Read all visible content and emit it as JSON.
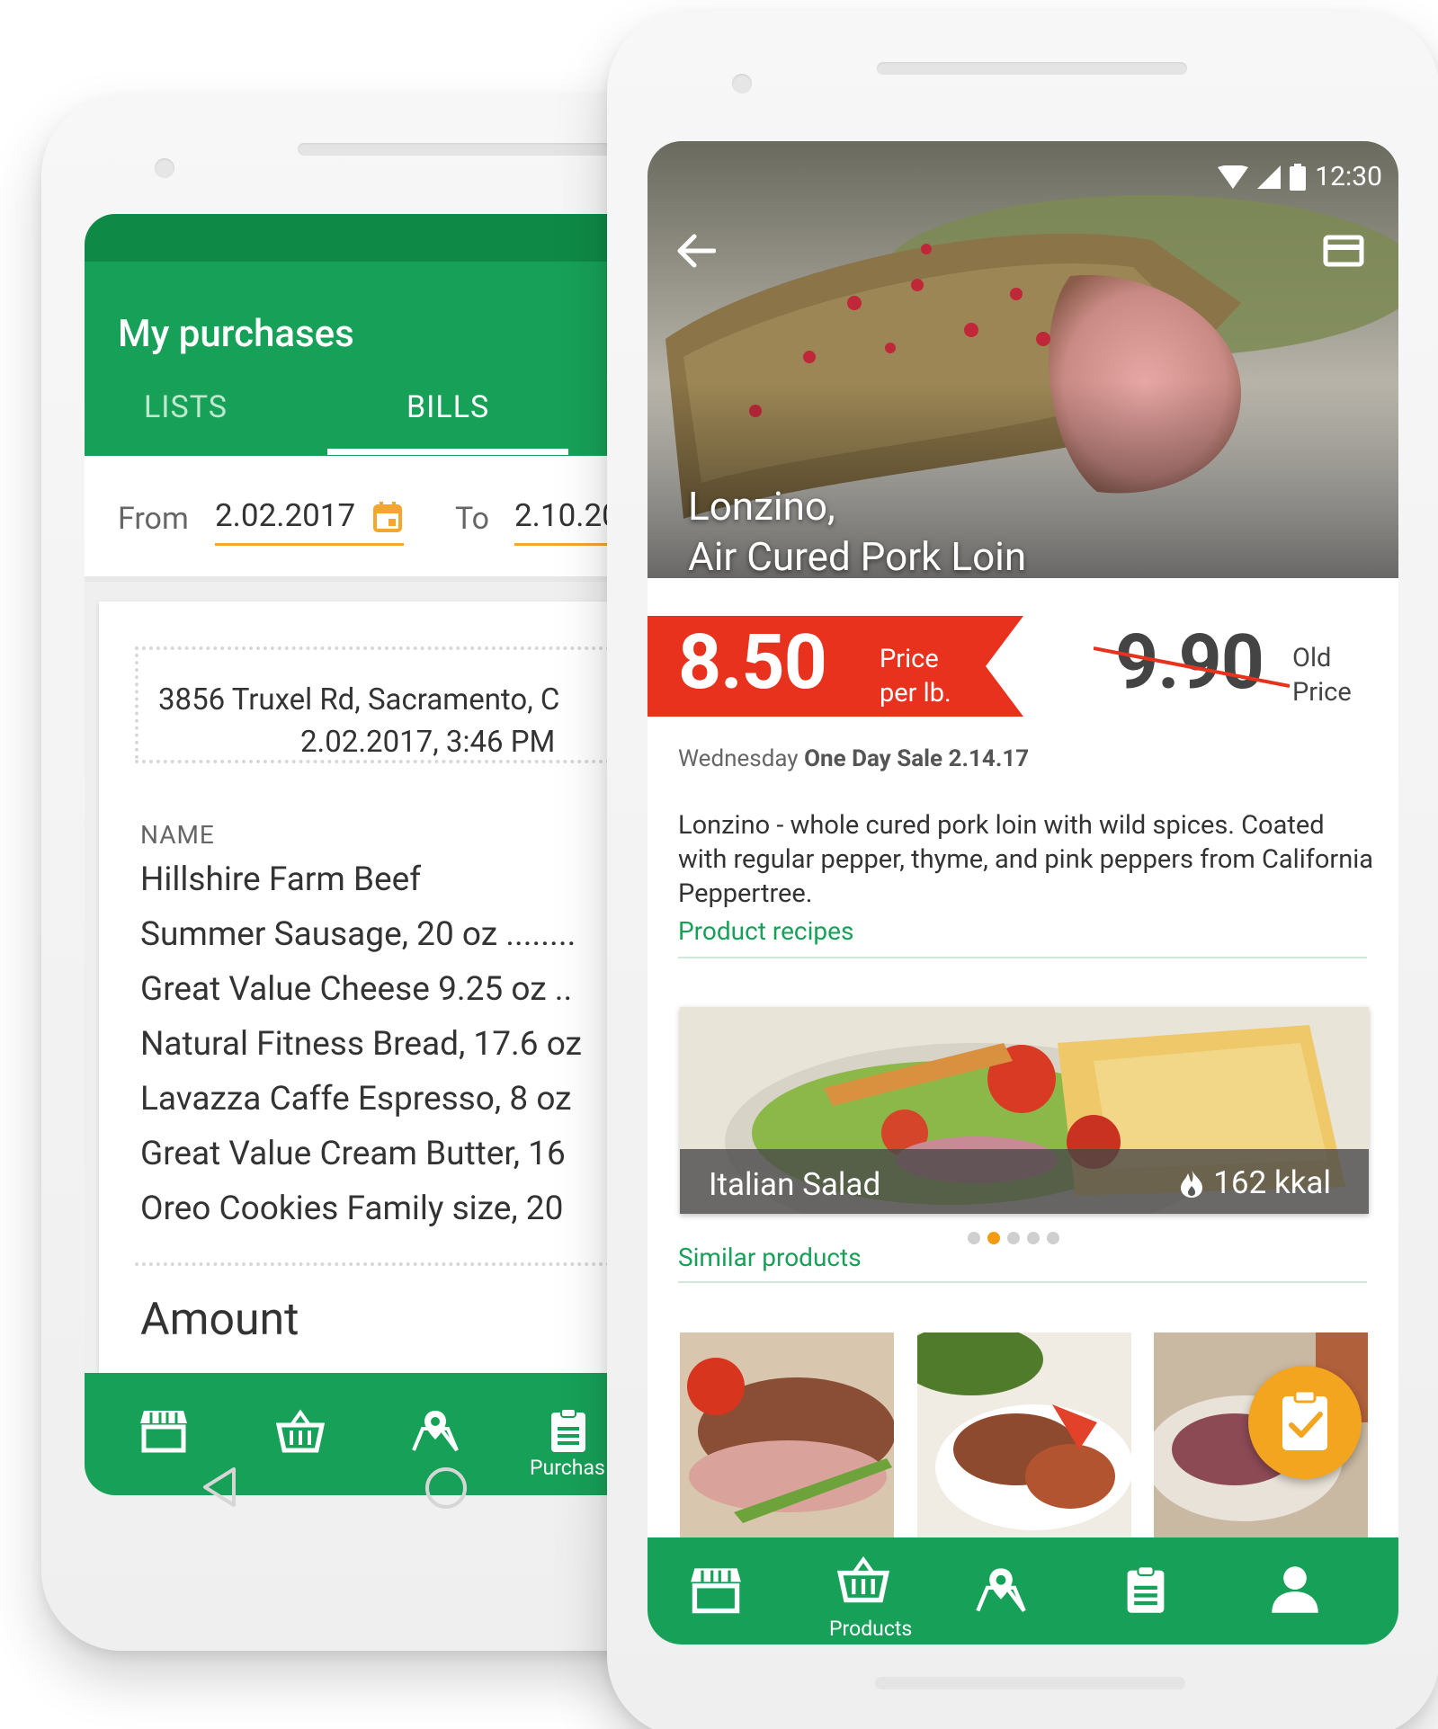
{
  "back_phone": {
    "title": "My purchases",
    "tabs": [
      {
        "label": "LISTS",
        "active": false
      },
      {
        "label": "BILLS",
        "active": true
      }
    ],
    "filter": {
      "from_label": "From",
      "from_value": "2.02.2017",
      "to_label": "To",
      "to_value": "2.10.20"
    },
    "bill": {
      "address": "3856 Truxel Rd, Sacramento, C",
      "datetime": "2.02.2017, 3:46 PM",
      "name_header": "NAME",
      "items": [
        "Hillshire Farm Beef",
        "Summer Sausage, 20 oz ........",
        "Great Value Cheese 9.25 oz ..",
        "Natural Fitness Bread, 17.6 oz",
        "Lavazza Caffe Espresso, 8 oz",
        "Great Value Cream Butter, 16",
        "Oreo Cookies Family size, 20"
      ],
      "amount_label": "Amount"
    },
    "bottom_nav": {
      "items": [
        {
          "icon": "store-icon"
        },
        {
          "icon": "basket-icon"
        },
        {
          "icon": "map-pin-icon"
        },
        {
          "icon": "clipboard-icon",
          "label": "Purchas",
          "active": true
        }
      ]
    }
  },
  "front_phone": {
    "status_time": "12:30",
    "product_title_line1": "Lonzino,",
    "product_title_line2": "Air Cured Pork Loin",
    "price": "8.50",
    "price_label_line1": "Price",
    "price_label_line2": "per lb.",
    "old_price": "9.90",
    "old_price_label_line1": "Old",
    "old_price_label_line2": "Price",
    "sale_prefix": "Wednesday",
    "sale_text": "One Day Sale 2.14.17",
    "description": "Lonzino - whole cured pork loin with wild spices. Coated with regular pepper, thyme, and pink peppers from California Peppertree.",
    "recipes_header": "Product recipes",
    "recipe": {
      "name": "Italian Salad",
      "kcal": "162 kkal"
    },
    "carousel": {
      "count": 5,
      "active": 1
    },
    "similar_header": "Similar products",
    "bottom_nav": {
      "items": [
        {
          "icon": "store-icon"
        },
        {
          "icon": "basket-icon",
          "label": "Products",
          "active": true
        },
        {
          "icon": "map-pin-icon"
        },
        {
          "icon": "clipboard-icon"
        },
        {
          "icon": "person-icon"
        }
      ]
    },
    "colors": {
      "brand_green": "#17a158",
      "price_red": "#e8321e",
      "fab_orange": "#f4a51f"
    }
  }
}
